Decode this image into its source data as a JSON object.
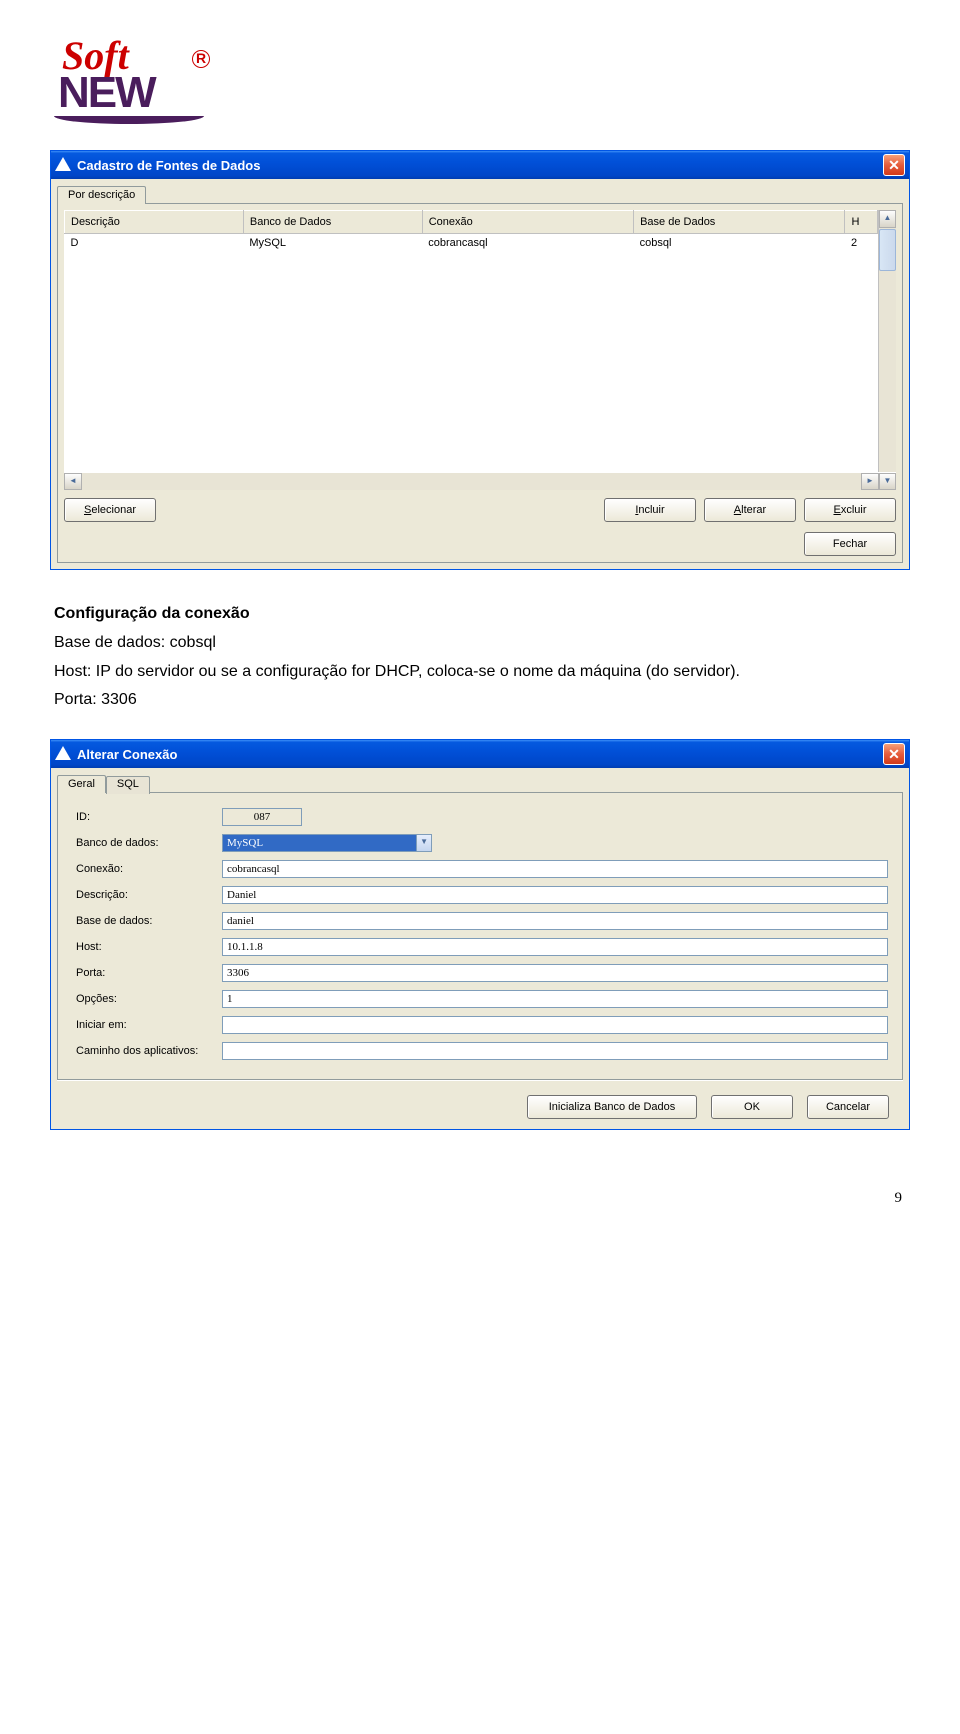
{
  "logo": {
    "soft": "Soft",
    "new": "NEW",
    "reg": "R"
  },
  "window1": {
    "title": "Cadastro de Fontes de Dados",
    "tab_label": "Por descrição",
    "columns": [
      "Descrição",
      "Banco de Dados",
      "Conexão",
      "Base de Dados",
      "H"
    ],
    "row": {
      "descricao": "D",
      "banco": "MySQL",
      "conexao": "cobrancasql",
      "base": "cobsql",
      "h": "2"
    },
    "buttons": {
      "selecionar": "Selecionar",
      "incluir": "Incluir",
      "alterar": "Alterar",
      "excluir": "Excluir",
      "fechar": "Fechar"
    }
  },
  "bodytext": {
    "heading": "Configuração da conexão",
    "line1": "Base de dados: cobsql",
    "line2": "Host: IP do servidor ou se a configuração for DHCP, coloca-se o nome da máquina (do servidor).",
    "line3": "Porta: 3306"
  },
  "window2": {
    "title": "Alterar Conexão",
    "tabs": {
      "geral": "Geral",
      "sql": "SQL"
    },
    "labels": {
      "id": "ID:",
      "banco": "Banco de dados:",
      "conexao": "Conexão:",
      "descricao": "Descrição:",
      "base": "Base de dados:",
      "host": "Host:",
      "porta": "Porta:",
      "opcoes": "Opções:",
      "iniciar": "Iniciar em:",
      "caminho": "Caminho dos aplicativos:"
    },
    "values": {
      "id": "087",
      "banco": "MySQL",
      "conexao": "cobrancasql",
      "descricao": "Daniel",
      "base": "daniel",
      "host": "10.1.1.8",
      "porta": "3306",
      "opcoes": "1",
      "iniciar": "",
      "caminho": ""
    },
    "buttons": {
      "init": "Inicializa Banco de Dados",
      "ok": "OK",
      "cancel": "Cancelar"
    }
  },
  "page_number": "9"
}
